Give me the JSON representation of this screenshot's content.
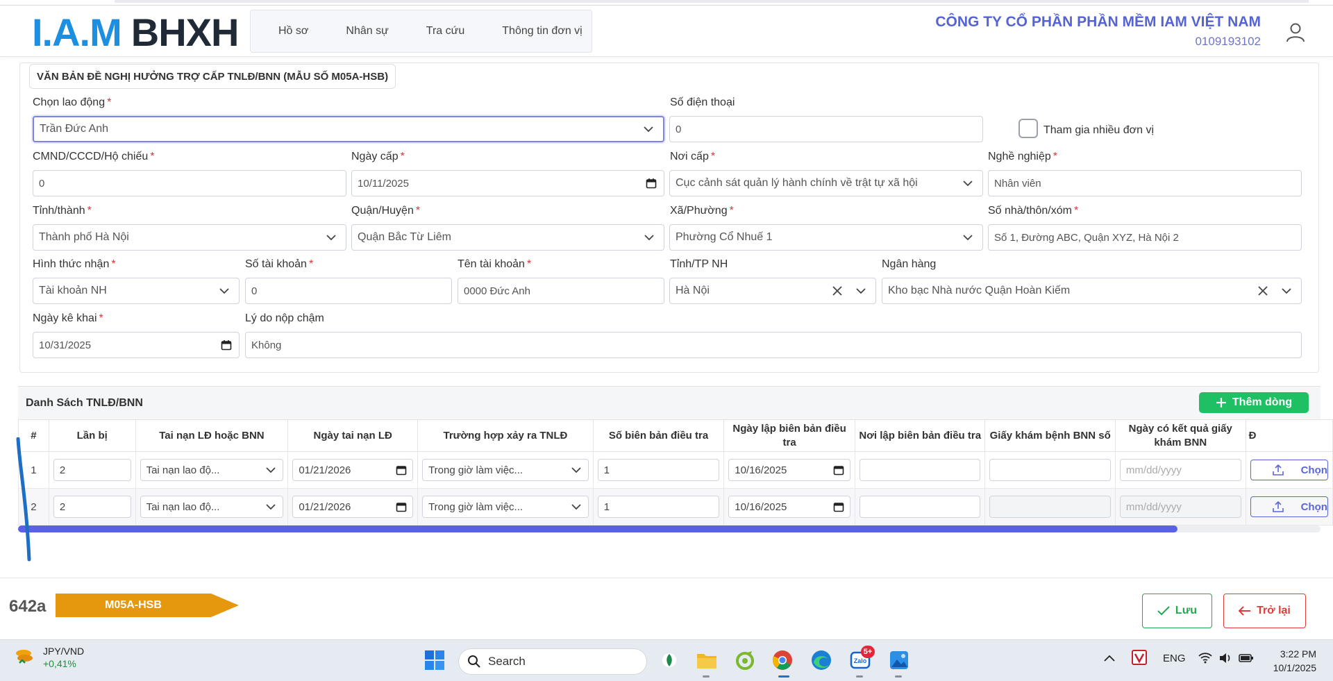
{
  "header": {
    "logo_part1": "I.A.M",
    "logo_part2": "BHXH",
    "nav": [
      "Hồ sơ",
      "Nhân sự",
      "Tra cứu",
      "Thông tin đơn vị"
    ],
    "company_name": "CÔNG TY CỔ PHẦN PHẦN MỀM IAM VIỆT NAM",
    "company_code": "0109193102"
  },
  "form": {
    "title": "VĂN BẢN ĐỀ NGHỊ HƯỞNG TRỢ CẤP TNLĐ/BNN (MẪU SỐ M05A-HSB)",
    "required_mark": "*",
    "employee": {
      "label": "Chọn lao động",
      "value": "Trần Đức Anh"
    },
    "phone": {
      "label": "Số điện thoại",
      "value": "0"
    },
    "multi_unit": {
      "label": "Tham gia nhiều đơn vị",
      "checked": false
    },
    "id_number": {
      "label": "CMND/CCCD/Hộ chiếu",
      "value": "0"
    },
    "issue_date": {
      "label": "Ngày cấp",
      "value": "10/11/2025"
    },
    "issue_place": {
      "label": "Nơi cấp",
      "value": "Cục cảnh sát quản lý hành chính về trật tự xã hội"
    },
    "occupation": {
      "label": "Nghề nghiệp",
      "value": "Nhân viên"
    },
    "province": {
      "label": "Tỉnh/thành",
      "value": "Thành phố Hà Nội"
    },
    "district": {
      "label": "Quận/Huyện",
      "value": "Quận Bắc Từ Liêm"
    },
    "ward": {
      "label": "Xã/Phường",
      "value": "Phường Cổ Nhuế 1"
    },
    "address": {
      "label": "Số nhà/thôn/xóm",
      "value": "Số 1, Đường ABC, Quận XYZ, Hà Nội 2"
    },
    "receive_method": {
      "label": "Hình thức nhận",
      "value": "Tài khoản NH"
    },
    "account_number": {
      "label": "Số tài khoản",
      "value": "0"
    },
    "account_name": {
      "label": "Tên tài khoản",
      "value": "0000 Đức Anh"
    },
    "bank_province": {
      "label": "Tỉnh/TP NH",
      "value": "Hà Nội"
    },
    "bank": {
      "label": "Ngân hàng",
      "value": "Kho bạc Nhà nước Quận Hoàn Kiếm"
    },
    "declare_date": {
      "label": "Ngày kê khai",
      "value": "10/31/2025"
    },
    "late_reason": {
      "label": "Lý do nộp chậm",
      "value": "Không"
    }
  },
  "table": {
    "caption": "Danh Sách TNLĐ/BNN",
    "add_button": "Thêm dòng",
    "columns": [
      "#",
      "Lần bị",
      "Tai nạn LĐ hoặc BNN",
      "Ngày tai nạn LĐ",
      "Trường hợp xảy ra TNLĐ",
      "Số biên bản điều tra",
      "Ngày lập biên bản điều tra",
      "Nơi lập biên bản điều tra",
      "Giấy khám bệnh BNN số",
      "Ngày có kết quả giấy khám BNN",
      "Đ"
    ],
    "date_placeholder": "mm/dd/yyyy",
    "upload_label": "Chọn",
    "rows": [
      {
        "index": "1",
        "times": "2",
        "type": "Tai nạn lao độ...",
        "accident_date": "01/21/2026",
        "situation": "Trong giờ làm việc...",
        "report_no": "1",
        "report_date": "10/16/2025",
        "report_place": "",
        "bnn_paper": "",
        "result_date": ""
      },
      {
        "index": "2",
        "times": "2",
        "type": "Tai nạn lao độ...",
        "accident_date": "01/21/2026",
        "situation": "Trong giờ làm việc...",
        "report_no": "1",
        "report_date": "10/16/2025",
        "report_place": "",
        "bnn_paper": "",
        "result_date": ""
      }
    ],
    "scroll_fraction": 0.89
  },
  "footer": {
    "form_code": "642a",
    "form_tag": "M05A-HSB",
    "save_label": "Lưu",
    "back_label": "Trở lại"
  },
  "taskbar": {
    "widget_symbol": "JPY/VND",
    "widget_change": "+0,41%",
    "search_label": "Search",
    "zalo_badge": "5+",
    "language": "ENG",
    "time": "3:22 PM",
    "date": "10/1/2025"
  },
  "colors": {
    "accent": "#5a60e8",
    "company": "#5664d2",
    "add_button": "#1fbf64",
    "save": "#22a84f",
    "back": "#e03a3a",
    "tag": "#e5970e",
    "logo_blue": "#1d8fe0"
  }
}
